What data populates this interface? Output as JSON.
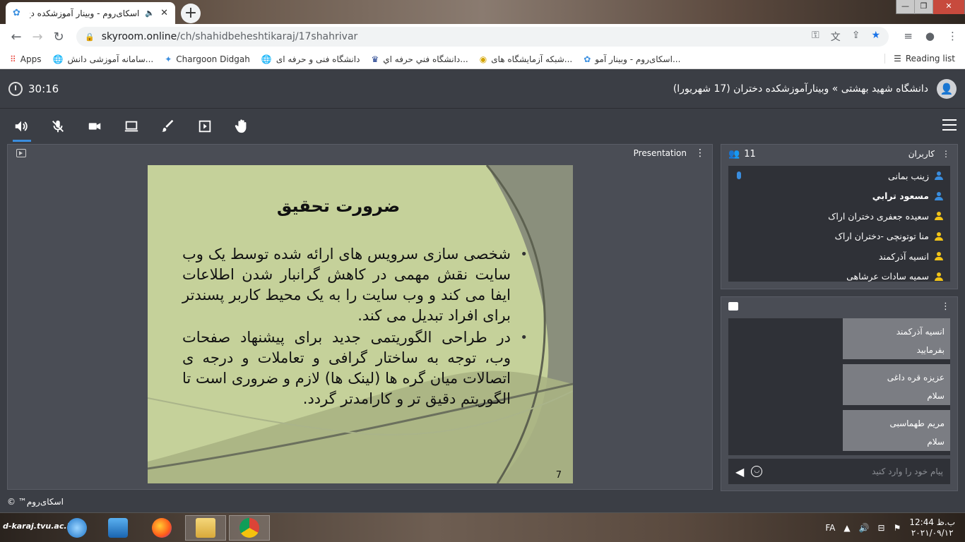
{
  "browser": {
    "tab_title": "اسکای‌روم - وبینار آموزشکده دخ",
    "url_domain": "skyroom.online",
    "url_path": "/ch/shahidbeheshtikaraj/17shahrivar",
    "bookmarks": [
      {
        "label": "Apps",
        "icon": "apps-grid-icon"
      },
      {
        "label": "سامانه آموزشی دانش...",
        "icon": "globe-icon"
      },
      {
        "label": "Chargoon Didgah",
        "icon": "didgah-icon"
      },
      {
        "label": "دانشگاه فنی و حرفه ای",
        "icon": "globe-icon"
      },
      {
        "label": "دانشگاه فني حرفه اي...",
        "icon": "university-icon"
      },
      {
        "label": "شبکه آزمایشگاه های...",
        "icon": "lab-icon"
      },
      {
        "label": "اسکای‌روم - وبینار آمو...",
        "icon": "skyroom-icon"
      }
    ],
    "reading_list": "Reading list",
    "colors": {
      "accent": "#1a73e8"
    }
  },
  "app": {
    "timer": "30:16",
    "room_title": "دانشگاه شهید بهشتی » وبینارآموزشکده دختران (17 شهریورا)",
    "presentation_label": "Presentation",
    "colors": {
      "background": "#3b3e45",
      "panel": "#4a4d55",
      "active": "#3a8dde",
      "moderator": "#3a8dde",
      "user": "#f2c418"
    },
    "slide": {
      "title": "ضرورت تحقیق",
      "bullets": [
        "شخصی سازی سرویس های ارائه شده توسط یک وب سایت نقش مهمی در کاهش گرانبار شدن اطلاعات ایفا می کند و وب سایت را به یک محیط کاربر پسندتر برای افراد تبدیل می کند.",
        "در طراحی الگوریتمی جدید برای پیشنهاد صفحات وب، توجه به ساختار گرافی و تعاملات و درجه ی اتصالات میان گره ها (لینک ها) لازم و ضروری است تا الگوریتم دقیق تر و کارامدتر گردد."
      ],
      "page_number": "7"
    },
    "users": {
      "title": "کاربران",
      "count": "11",
      "items": [
        {
          "name": "زینب بمانی",
          "role": "moderator",
          "mic": true
        },
        {
          "name": "مسعود ترابي",
          "role": "moderator",
          "bold": true
        },
        {
          "name": "سعیده جعفری دختران اراک",
          "role": "user"
        },
        {
          "name": "منا توتونچی -دختران اراک",
          "role": "user"
        },
        {
          "name": "انسیه آذرکمند",
          "role": "user"
        },
        {
          "name": "سمیه سادات عرشاهی",
          "role": "user"
        }
      ]
    },
    "chat": {
      "messages": [
        {
          "sender": "انسیه آذرکمند",
          "text": "بفرمایید"
        },
        {
          "sender": "عزیزه قره داغی",
          "text": "سلام"
        },
        {
          "sender": "مریم طهماسبی",
          "text": "سلام"
        }
      ],
      "placeholder": "پیام خود را وارد کنید"
    },
    "footer": "اسکای‌روم™ ©"
  },
  "taskbar": {
    "logo": "d-karaj.tvu.ac.ir",
    "language": "FA",
    "time": "12:44 ب.ظ",
    "date": "۲۰۲۱/۰۹/۱۲"
  }
}
